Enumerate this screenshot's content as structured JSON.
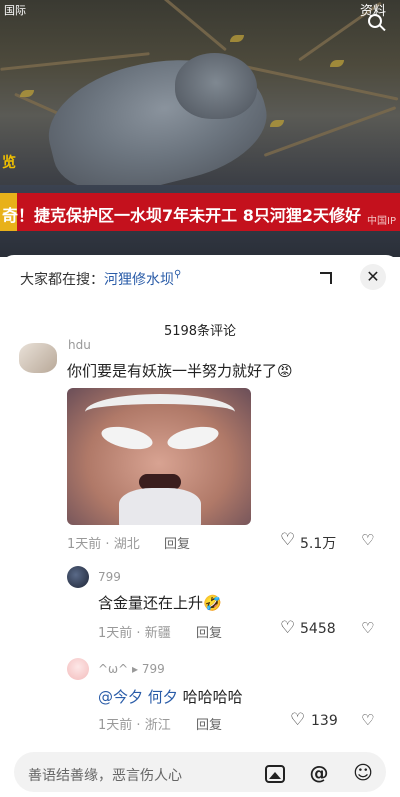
{
  "video": {
    "top_right_label": "资料",
    "channel_label": "国际",
    "news_ticker": "奇！捷克保护区一水坝7年未开工 8只河狸2天修好",
    "ticker_source": "中国IP",
    "corner_badge": "览"
  },
  "panel": {
    "hot_search_label": "大家都在搜：",
    "hot_search_term": "河狸修水坝",
    "comment_count": "5198条评论"
  },
  "comments": [
    {
      "username": "hdu",
      "text": "你们要是有妖族一半努力就好了😡",
      "time": "1天前",
      "location": "湖北",
      "reply_label": "回复",
      "likes": "5.1万"
    },
    {
      "username": "799",
      "text": "含金量还在上升🤣",
      "time": "1天前",
      "location": "新疆",
      "reply_label": "回复",
      "likes": "5458"
    },
    {
      "username": "^ω^",
      "reply_to": "799",
      "mentions": [
        "@今夕",
        "何夕"
      ],
      "text": "哈哈哈哈",
      "time": "1天前",
      "location": "浙江",
      "reply_label": "回复",
      "likes": "139"
    }
  ],
  "input": {
    "placeholder": "善语结善缘，恶言伤人心"
  },
  "icons": [
    "search-icon",
    "expand-icon",
    "close-icon",
    "heart-icon",
    "dislike-icon",
    "image-icon",
    "at-icon",
    "emoji-icon"
  ]
}
